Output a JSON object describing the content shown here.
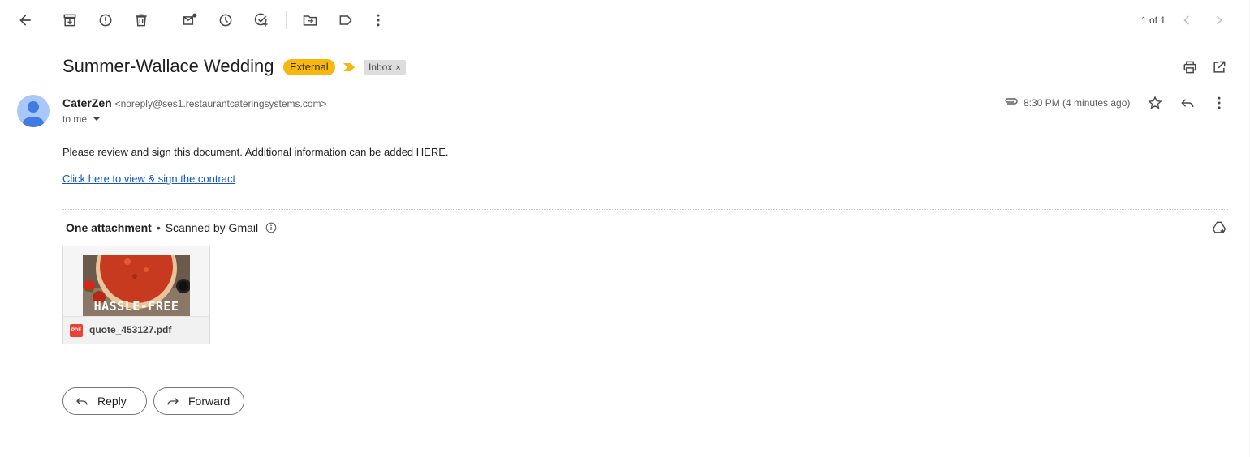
{
  "toolbar": {
    "pager": "1 of 1"
  },
  "message": {
    "subject": "Summer-Wallace Wedding",
    "external_badge": "External",
    "label": "Inbox",
    "label_remove": "×",
    "sender_name": "CaterZen",
    "sender_email": "<noreply@ses1.restaurantcateringsystems.com>",
    "recipient": "to me",
    "time": "8:30 PM (4 minutes ago)",
    "body": "Please review and sign this document. Additional information can be added HERE.",
    "link_text": "Click here to view & sign the contract"
  },
  "attachments": {
    "header": "One attachment",
    "bullet": "•",
    "scanned": "Scanned by Gmail",
    "file_name": "quote_453127.pdf",
    "file_type": "PDF",
    "thumb_text": "HASSLE-FREE"
  },
  "actions": {
    "reply": "Reply",
    "forward": "Forward"
  },
  "colors": {
    "external_badge": "#f6b80f",
    "link": "#1155cc",
    "pdf_red": "#ea4335"
  }
}
